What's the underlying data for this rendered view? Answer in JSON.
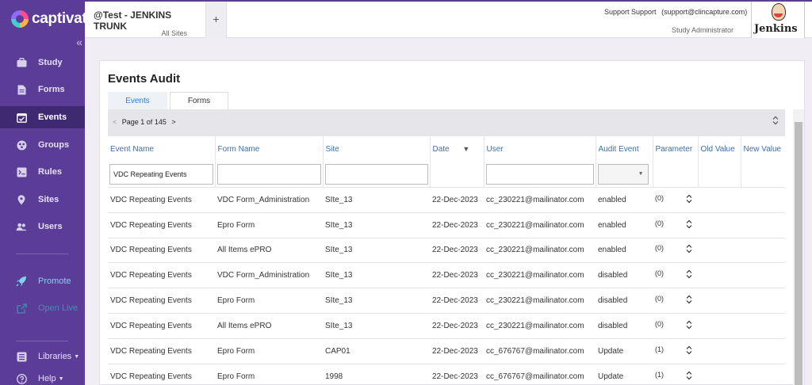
{
  "brand": "captivate",
  "sidebar": {
    "items": [
      {
        "label": "Study",
        "icon": "briefcase-icon"
      },
      {
        "label": "Forms",
        "icon": "document-icon"
      },
      {
        "label": "Events",
        "icon": "calendar-check-icon"
      },
      {
        "label": "Groups",
        "icon": "groups-icon"
      },
      {
        "label": "Rules",
        "icon": "rules-icon"
      },
      {
        "label": "Sites",
        "icon": "location-pin-icon"
      },
      {
        "label": "Users",
        "icon": "users-icon"
      }
    ],
    "promote_label": "Promote",
    "open_live_label": "Open Live",
    "libraries_label": "Libraries",
    "help_label": "Help"
  },
  "header": {
    "study_title": "@Test - JENKINS TRUNK",
    "site_label": "All Sites",
    "add_tab": "+",
    "user_name": "Support Support",
    "user_email": "(support@clincapture.com)",
    "user_role": "Study Administrator",
    "jenkins_label": "Jenkins"
  },
  "main": {
    "title": "Events Audit",
    "tabs": [
      "Events",
      "Forms"
    ],
    "pager": {
      "prev": "<",
      "text": "Page 1 of 145",
      "next": ">"
    },
    "columns": [
      "Event Name",
      "Form Name",
      "Site",
      "Date",
      "User",
      "Audit Event",
      "Parameter",
      "Old Value",
      "New Value"
    ],
    "sort_indicator": "▼",
    "filter_event_name": "VDC Repeating Events",
    "rows": [
      {
        "event": "VDC Repeating Events",
        "form": "VDC Form_Administration",
        "site": "SIte_13",
        "date": "22-Dec-2023",
        "user": "cc_230221@mailinator.com",
        "audit": "enabled",
        "param": "(0)"
      },
      {
        "event": "VDC Repeating Events",
        "form": "Epro Form",
        "site": "SIte_13",
        "date": "22-Dec-2023",
        "user": "cc_230221@mailinator.com",
        "audit": "enabled",
        "param": "(0)"
      },
      {
        "event": "VDC Repeating Events",
        "form": "All Items ePRO",
        "site": "SIte_13",
        "date": "22-Dec-2023",
        "user": "cc_230221@mailinator.com",
        "audit": "enabled",
        "param": "(0)"
      },
      {
        "event": "VDC Repeating Events",
        "form": "VDC Form_Administration",
        "site": "SIte_13",
        "date": "22-Dec-2023",
        "user": "cc_230221@mailinator.com",
        "audit": "disabled",
        "param": "(0)"
      },
      {
        "event": "VDC Repeating Events",
        "form": "Epro Form",
        "site": "SIte_13",
        "date": "22-Dec-2023",
        "user": "cc_230221@mailinator.com",
        "audit": "disabled",
        "param": "(0)"
      },
      {
        "event": "VDC Repeating Events",
        "form": "All Items ePRO",
        "site": "SIte_13",
        "date": "22-Dec-2023",
        "user": "cc_230221@mailinator.com",
        "audit": "disabled",
        "param": "(0)"
      },
      {
        "event": "VDC Repeating Events",
        "form": "Epro Form",
        "site": "CAP01",
        "date": "22-Dec-2023",
        "user": "cc_676767@mailinator.com",
        "audit": "Update",
        "param": "(1)"
      },
      {
        "event": "VDC Repeating Events",
        "form": "Epro Form",
        "site": "1998",
        "date": "22-Dec-2023",
        "user": "cc_676767@mailinator.com",
        "audit": "Update",
        "param": "(1)"
      }
    ]
  }
}
